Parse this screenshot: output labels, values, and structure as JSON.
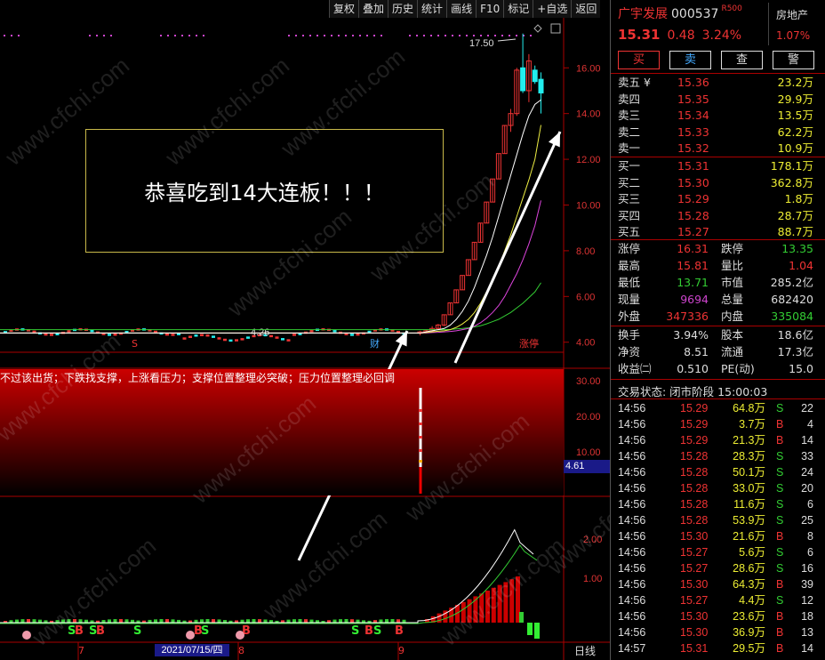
{
  "toolbar": [
    "复权",
    "叠加",
    "历史",
    "统计",
    "画线",
    "F10",
    "标记",
    "+自选",
    "返回"
  ],
  "chart": {
    "banner": "恭喜吃到14大连板！！！",
    "indicator_text": "不过该出货；下跌找支撑，上涨看压力；支撑位置整理必突破；压力位置整理必回调",
    "price_axis": [
      "16.00",
      "14.00",
      "12.00",
      "10.00",
      "8.00",
      "6.00",
      "4.00"
    ],
    "mid_axis": [
      "30.00",
      "20.00",
      "10.00"
    ],
    "low_axis": [
      "2.00",
      "1.00"
    ],
    "high_label": "17.50",
    "low_label": "4.26",
    "current_value": "4.61",
    "date_label": "2021/07/15/四",
    "month_labels": [
      "7",
      "8",
      "9"
    ],
    "period": "日线",
    "markers": {
      "s": "S",
      "cai": "财",
      "zhang": "涨停",
      "b": "B"
    },
    "watermark": "www.cfchi.com",
    "colors": {
      "up": "#e33",
      "down": "#2ee",
      "ma5": "#ffffff",
      "ma10": "#eeee44",
      "ma20": "#dd44dd",
      "ma60": "#33cc33"
    }
  },
  "chart_data": {
    "type": "candlestick",
    "price_ticks": [
      4,
      6,
      8,
      10,
      12,
      14,
      16
    ],
    "ylim": [
      3.6,
      17.8
    ],
    "candles": [
      {
        "o": 4.4,
        "h": 4.5,
        "l": 4.3,
        "c": 4.45
      },
      {
        "o": 4.45,
        "h": 4.55,
        "l": 4.4,
        "c": 4.5
      },
      {
        "o": 4.5,
        "h": 4.7,
        "l": 4.45,
        "c": 4.6
      },
      {
        "o": 4.6,
        "h": 4.8,
        "l": 4.55,
        "c": 4.75
      },
      {
        "o": 4.75,
        "h": 5.2,
        "l": 4.7,
        "c": 5.2
      },
      {
        "o": 5.2,
        "h": 5.72,
        "l": 5.2,
        "c": 5.72
      },
      {
        "o": 5.72,
        "h": 6.29,
        "l": 5.72,
        "c": 6.29
      },
      {
        "o": 6.29,
        "h": 6.92,
        "l": 6.29,
        "c": 6.92
      },
      {
        "o": 6.92,
        "h": 7.61,
        "l": 6.92,
        "c": 7.61
      },
      {
        "o": 7.61,
        "h": 8.37,
        "l": 7.61,
        "c": 8.37
      },
      {
        "o": 8.37,
        "h": 9.21,
        "l": 8.37,
        "c": 9.21
      },
      {
        "o": 9.21,
        "h": 10.13,
        "l": 9.21,
        "c": 10.13
      },
      {
        "o": 10.13,
        "h": 11.14,
        "l": 10.13,
        "c": 11.14
      },
      {
        "o": 11.14,
        "h": 12.25,
        "l": 11.14,
        "c": 12.25
      },
      {
        "o": 12.25,
        "h": 13.48,
        "l": 12.25,
        "c": 13.48
      },
      {
        "o": 13.48,
        "h": 14.2,
        "l": 13.2,
        "c": 14.0
      },
      {
        "o": 14.0,
        "h": 16.0,
        "l": 13.9,
        "c": 15.9
      },
      {
        "o": 16.0,
        "h": 17.5,
        "l": 14.9,
        "c": 15.0
      },
      {
        "o": 15.0,
        "h": 16.6,
        "l": 14.5,
        "c": 16.3
      },
      {
        "o": 15.9,
        "h": 16.1,
        "l": 15.3,
        "c": 15.4
      },
      {
        "o": 15.5,
        "h": 15.8,
        "l": 14.0,
        "c": 14.9
      }
    ],
    "ma5": [
      4.4,
      4.45,
      4.5,
      4.55,
      4.6,
      4.75,
      5.0,
      5.35,
      5.8,
      6.4,
      7.1,
      7.8,
      8.6,
      9.5,
      10.4,
      11.3,
      12.2,
      13.1,
      13.9,
      14.4,
      14.6
    ],
    "ma10": [
      4.4,
      4.42,
      4.45,
      4.48,
      4.5,
      4.55,
      4.65,
      4.8,
      5.0,
      5.3,
      5.7,
      6.2,
      6.7,
      7.3,
      8.0,
      8.7,
      9.5,
      10.3,
      11.1,
      12.0,
      13.5
    ],
    "ma20": [
      4.4,
      4.4,
      4.42,
      4.43,
      4.45,
      4.47,
      4.5,
      4.55,
      4.6,
      4.7,
      4.85,
      5.05,
      5.3,
      5.6,
      6.0,
      6.5,
      7.0,
      7.6,
      8.3,
      9.1,
      10.2
    ],
    "ma60": [
      4.55,
      4.55,
      4.55,
      4.55,
      4.55,
      4.56,
      4.58,
      4.6,
      4.63,
      4.67,
      4.72,
      4.8,
      4.9,
      5.0,
      5.15,
      5.3,
      5.5,
      5.7,
      5.95,
      6.2,
      6.6
    ]
  },
  "panel": {
    "name": "广宇发展",
    "code": "000537",
    "r_tag": "R500",
    "sector": "房地产",
    "sector_pct": "1.07%",
    "price": "15.31",
    "change": "0.48",
    "change_pct": "3.24%",
    "buttons": [
      "买",
      "卖",
      "查",
      "警"
    ],
    "asks": [
      {
        "label": "卖五 ¥",
        "price": "15.36",
        "vol": "23.2万"
      },
      {
        "label": "卖四",
        "price": "15.35",
        "vol": "29.9万"
      },
      {
        "label": "卖三",
        "price": "15.34",
        "vol": "13.5万"
      },
      {
        "label": "卖二",
        "price": "15.33",
        "vol": "62.2万"
      },
      {
        "label": "卖一",
        "price": "15.32",
        "vol": "10.9万"
      }
    ],
    "bids": [
      {
        "label": "买一",
        "price": "15.31",
        "vol": "178.1万"
      },
      {
        "label": "买二",
        "price": "15.30",
        "vol": "362.8万"
      },
      {
        "label": "买三",
        "price": "15.29",
        "vol": "1.8万"
      },
      {
        "label": "买四",
        "price": "15.28",
        "vol": "28.7万"
      },
      {
        "label": "买五",
        "price": "15.27",
        "vol": "88.7万"
      }
    ],
    "stats1": [
      {
        "k": "涨停",
        "v": "16.31",
        "c": "#e33",
        "k2": "跌停",
        "v2": "13.35",
        "c2": "#3c3"
      },
      {
        "k": "最高",
        "v": "15.81",
        "c": "#e33",
        "k2": "量比",
        "v2": "1.04",
        "c2": "#e33"
      },
      {
        "k": "最低",
        "v": "13.71",
        "c": "#3c3",
        "k2": "市值",
        "v2": "285.2亿",
        "c2": "#ddd"
      },
      {
        "k": "现量",
        "v": "9694",
        "c": "#c4c",
        "k2": "总量",
        "v2": "682420",
        "c2": "#ddd"
      },
      {
        "k": "外盘",
        "v": "347336",
        "c": "#e33",
        "k2": "内盘",
        "v2": "335084",
        "c2": "#3c3"
      }
    ],
    "stats2": [
      {
        "k": "换手",
        "v": "3.94%",
        "k2": "股本",
        "v2": "18.6亿"
      },
      {
        "k": "净资",
        "v": "8.51",
        "k2": "流通",
        "v2": "17.3亿"
      },
      {
        "k": "收益㈡",
        "v": "0.510",
        "k2": "PE(动)",
        "v2": "15.0"
      }
    ],
    "trade_status": "交易状态: 闭市阶段 15:00:03",
    "ticks": [
      {
        "t": "14:56",
        "p": "15.29",
        "v": "64.8万",
        "d": "S",
        "n": "22"
      },
      {
        "t": "14:56",
        "p": "15.29",
        "v": "3.7万",
        "d": "B",
        "n": "4"
      },
      {
        "t": "14:56",
        "p": "15.29",
        "v": "21.3万",
        "d": "B",
        "n": "14"
      },
      {
        "t": "14:56",
        "p": "15.28",
        "v": "28.3万",
        "d": "S",
        "n": "33"
      },
      {
        "t": "14:56",
        "p": "15.28",
        "v": "50.1万",
        "d": "S",
        "n": "24"
      },
      {
        "t": "14:56",
        "p": "15.28",
        "v": "33.0万",
        "d": "S",
        "n": "20"
      },
      {
        "t": "14:56",
        "p": "15.28",
        "v": "11.6万",
        "d": "S",
        "n": "6"
      },
      {
        "t": "14:56",
        "p": "15.28",
        "v": "53.9万",
        "d": "S",
        "n": "25"
      },
      {
        "t": "14:56",
        "p": "15.30",
        "v": "21.6万",
        "d": "B",
        "n": "8"
      },
      {
        "t": "14:56",
        "p": "15.27",
        "v": "5.6万",
        "d": "S",
        "n": "6"
      },
      {
        "t": "14:56",
        "p": "15.27",
        "v": "28.6万",
        "d": "S",
        "n": "16"
      },
      {
        "t": "14:56",
        "p": "15.30",
        "v": "64.3万",
        "d": "B",
        "n": "39"
      },
      {
        "t": "14:56",
        "p": "15.27",
        "v": "4.4万",
        "d": "S",
        "n": "12"
      },
      {
        "t": "14:56",
        "p": "15.30",
        "v": "23.6万",
        "d": "B",
        "n": "18"
      },
      {
        "t": "14:56",
        "p": "15.30",
        "v": "36.9万",
        "d": "B",
        "n": "13"
      },
      {
        "t": "14:57",
        "p": "15.31",
        "v": "29.5万",
        "d": "B",
        "n": "14"
      }
    ]
  }
}
